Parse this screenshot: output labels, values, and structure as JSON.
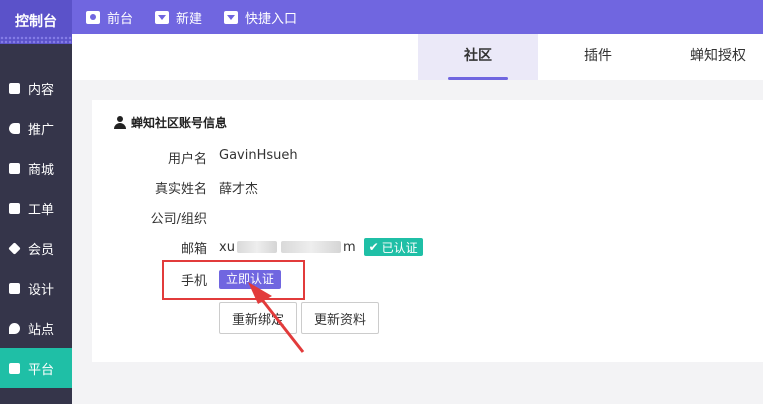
{
  "brand": {
    "title": "控制台"
  },
  "topnav": [
    {
      "label": "前台",
      "icon": "eye-icon"
    },
    {
      "label": "新建",
      "icon": "caret-down-icon"
    },
    {
      "label": "快捷入口",
      "icon": "caret-down-icon"
    }
  ],
  "sidebar": {
    "items": [
      {
        "label": "内容",
        "icon": "document-icon"
      },
      {
        "label": "推广",
        "icon": "megaphone-icon"
      },
      {
        "label": "商城",
        "icon": "shop-icon"
      },
      {
        "label": "工单",
        "icon": "ticket-icon"
      },
      {
        "label": "会员",
        "icon": "diamond-icon"
      },
      {
        "label": "设计",
        "icon": "design-icon"
      },
      {
        "label": "站点",
        "icon": "location-icon"
      },
      {
        "label": "平台",
        "icon": "platform-icon",
        "active": true
      }
    ]
  },
  "tabs": [
    {
      "label": "社区",
      "active": true
    },
    {
      "label": "插件"
    },
    {
      "label": "蝉知授权"
    }
  ],
  "account": {
    "title": "蝉知社区账号信息",
    "username_label": "用户名",
    "username": "GavinHsueh",
    "realname_label": "真实姓名",
    "realname": "薛才杰",
    "company_label": "公司/组织",
    "company": "",
    "email_label": "邮箱",
    "email_prefix": "xu",
    "email_suffix": "m",
    "email_verified": "已认证",
    "phone_label": "手机",
    "phone_action": "立即认证",
    "rebind_button": "重新绑定",
    "update_button": "更新资料"
  },
  "colors": {
    "accent": "#7066e0",
    "sidebar_bg": "#35354a",
    "active_green": "#1fbfa6",
    "highlight_red": "#e23b3b"
  }
}
